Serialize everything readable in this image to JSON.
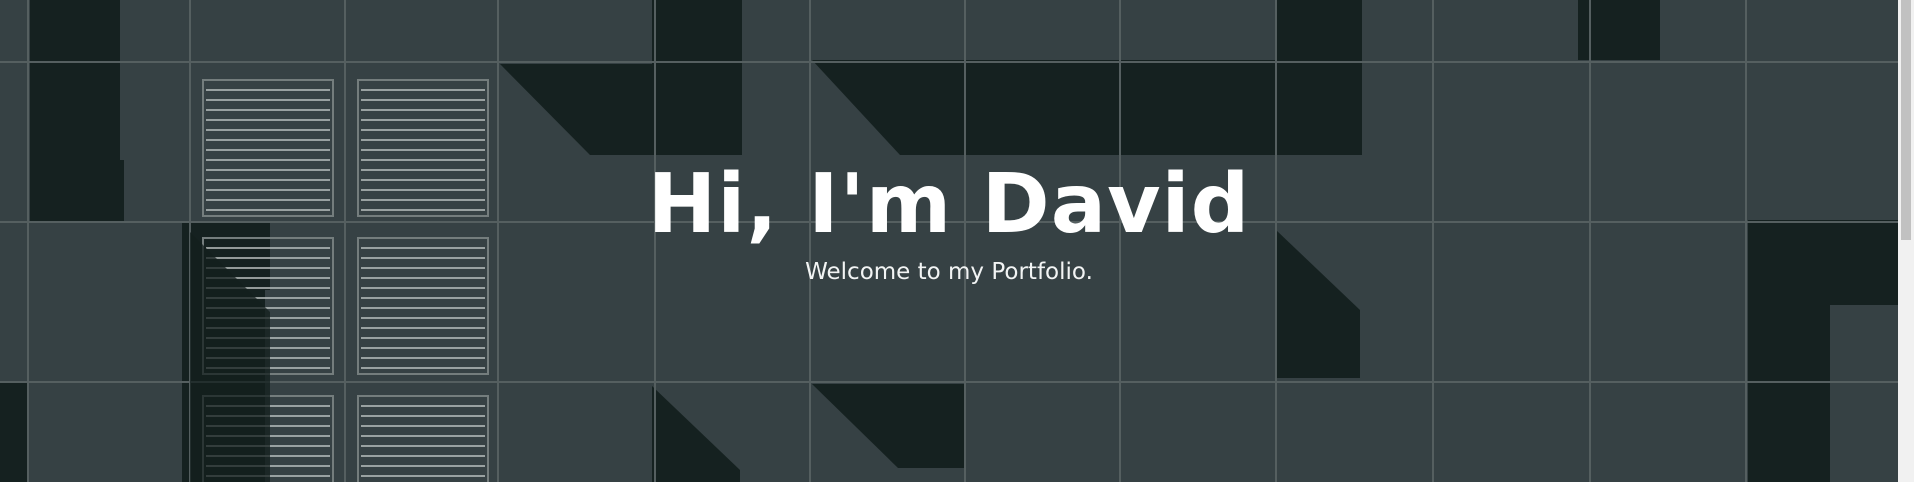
{
  "hero": {
    "title": "Hi, I'm David",
    "subtitle": "Welcome to my Portfolio."
  },
  "background": {
    "description_icon": "building-facade-image",
    "panel_color": "#3b474a",
    "shadow_color": "#152220",
    "seam_color": "#6c7676",
    "vent_color": "#b9c0c0"
  },
  "colors": {
    "text": "#ffffff",
    "scrollbar_track": "#f1f1f1",
    "scrollbar_thumb": "#c1c1c1"
  }
}
